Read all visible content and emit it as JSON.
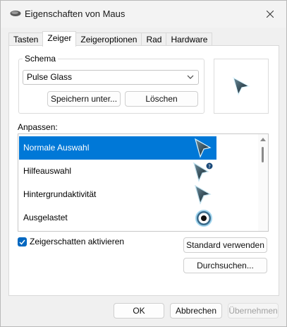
{
  "window": {
    "title": "Eigenschaften von Maus"
  },
  "tabs": [
    {
      "label": "Tasten"
    },
    {
      "label": "Zeiger",
      "active": true
    },
    {
      "label": "Zeigeroptionen"
    },
    {
      "label": "Rad"
    },
    {
      "label": "Hardware"
    }
  ],
  "schema": {
    "legend": "Schema",
    "selected": "Pulse Glass",
    "save_label": "Speichern unter...",
    "delete_label": "Löschen"
  },
  "customize": {
    "label": "Anpassen:",
    "items": [
      {
        "label": "Normale Auswahl",
        "icon": "arrow-pointer-icon",
        "selected": true
      },
      {
        "label": "Hilfeauswahl",
        "icon": "help-pointer-icon"
      },
      {
        "label": "Hintergrundaktivität",
        "icon": "working-pointer-icon"
      },
      {
        "label": "Ausgelastet",
        "icon": "busy-circle-icon"
      }
    ]
  },
  "shadow": {
    "label": "Zeigerschatten aktivieren",
    "checked": true
  },
  "buttons": {
    "default_label": "Standard verwenden",
    "browse_label": "Durchsuchen...",
    "ok_label": "OK",
    "cancel_label": "Abbrechen",
    "apply_label": "Übernehmen"
  },
  "colors": {
    "accent": "#0078d7",
    "checkbox": "#0067c0"
  }
}
